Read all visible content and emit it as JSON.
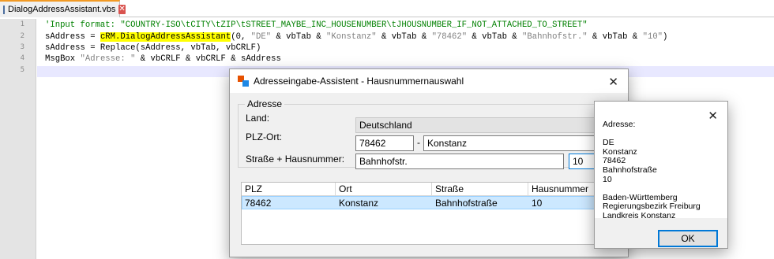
{
  "editor": {
    "tab_title": "DialogAddressAssistant.vbs",
    "line_numbers": [
      "1",
      "2",
      "3",
      "4",
      "5"
    ],
    "lines": [
      [
        {
          "t": "'Input format: \"COUNTRY-ISO\\tCITY\\tZIP\\tSTREET_MAYBE_INC_HOUSENUMBER\\tJHOUSNUMBER_IF_NOT_ATTACHED_TO_STREET\"",
          "c": "comment"
        }
      ],
      [
        {
          "t": "sAddress = ",
          "c": ""
        },
        {
          "t": "cRM.DialogAddressAssistant",
          "c": "hl"
        },
        {
          "t": "(0, ",
          "c": ""
        },
        {
          "t": "\"DE\"",
          "c": "str"
        },
        {
          "t": " & vbTab & ",
          "c": ""
        },
        {
          "t": "\"Konstanz\"",
          "c": "str"
        },
        {
          "t": " & vbTab & ",
          "c": ""
        },
        {
          "t": "\"78462\"",
          "c": "str"
        },
        {
          "t": " & vbTab & ",
          "c": ""
        },
        {
          "t": "\"Bahnhofstr.\"",
          "c": "str"
        },
        {
          "t": " & vbTab & ",
          "c": ""
        },
        {
          "t": "\"10\"",
          "c": "str"
        },
        {
          "t": ")",
          "c": ""
        }
      ],
      [
        {
          "t": "sAddress = Replace(sAddress, vbTab, vbCRLF)",
          "c": ""
        }
      ],
      [
        {
          "t": "MsgBox ",
          "c": ""
        },
        {
          "t": "\"Adresse: \"",
          "c": "str"
        },
        {
          "t": " & vbCRLF & vbCRLF & sAddress",
          "c": ""
        }
      ],
      []
    ]
  },
  "dialog": {
    "title": "Adresseingabe-Assistent - Hausnummernauswahl",
    "group_label": "Adresse",
    "country_label": "Land:",
    "country_value": "Deutschland",
    "zipcity_label": "PLZ-Ort:",
    "zip_value": "78462",
    "dash": "-",
    "city_value": "Konstanz",
    "street_label": "Straße + Hausnummer:",
    "street_value": "Bahnhofstr.",
    "housenumber_value": "10",
    "close_symbol": "✕",
    "grid": {
      "columns": [
        "PLZ",
        "Ort",
        "Straße",
        "Hausnummer"
      ],
      "rows": [
        [
          "78462",
          "Konstanz",
          "Bahnhofstraße",
          "10"
        ]
      ]
    }
  },
  "msgbox": {
    "close_symbol": "✕",
    "text": "Adresse:\n\nDE\nKonstanz\n78462\nBahnhofstraße\n10\n\nBaden-Württemberg\nRegierungsbezirk Freiburg\nLandkreis Konstanz",
    "ok_label": "OK"
  },
  "colors": {
    "tab_accent": "#f29a25",
    "current_line": "#e8e8ff",
    "highlight": "#ffff00",
    "selection": "#cce8ff",
    "focus": "#0078d7"
  }
}
